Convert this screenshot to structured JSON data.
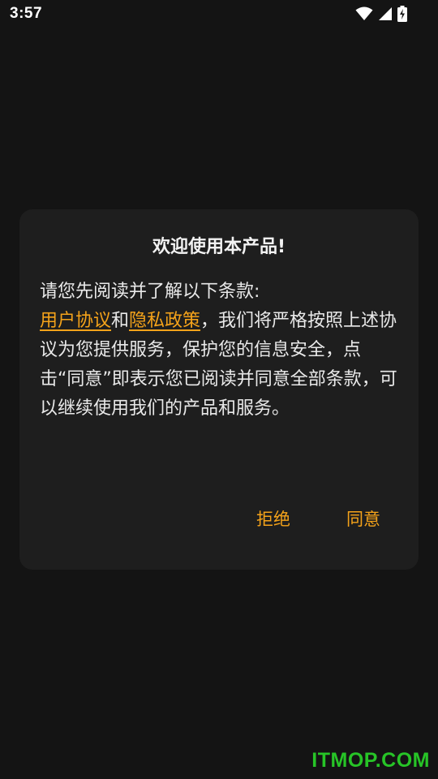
{
  "status_bar": {
    "time": "3:57",
    "icons": [
      "wifi-icon",
      "signal-icon",
      "battery-charging-icon"
    ]
  },
  "dialog": {
    "title": "欢迎使用本产品!",
    "intro": "请您先阅读并了解以下条款:",
    "link_user_agreement": "用户协议",
    "conjunction": "和",
    "link_privacy_policy": "隐私政策",
    "body_rest": "，我们将严格按照上述协议为您提供服务，保护您的信息安全，点击“同意”即表示您已阅读并同意全部条款，可以继续使用我们的产品和服务。",
    "reject_label": "拒绝",
    "agree_label": "同意"
  },
  "watermark": "ITMOP.COM",
  "colors": {
    "background": "#141414",
    "dialog": "#1e1e1e",
    "accent": "#f5a31a",
    "watermark": "#27c427"
  }
}
